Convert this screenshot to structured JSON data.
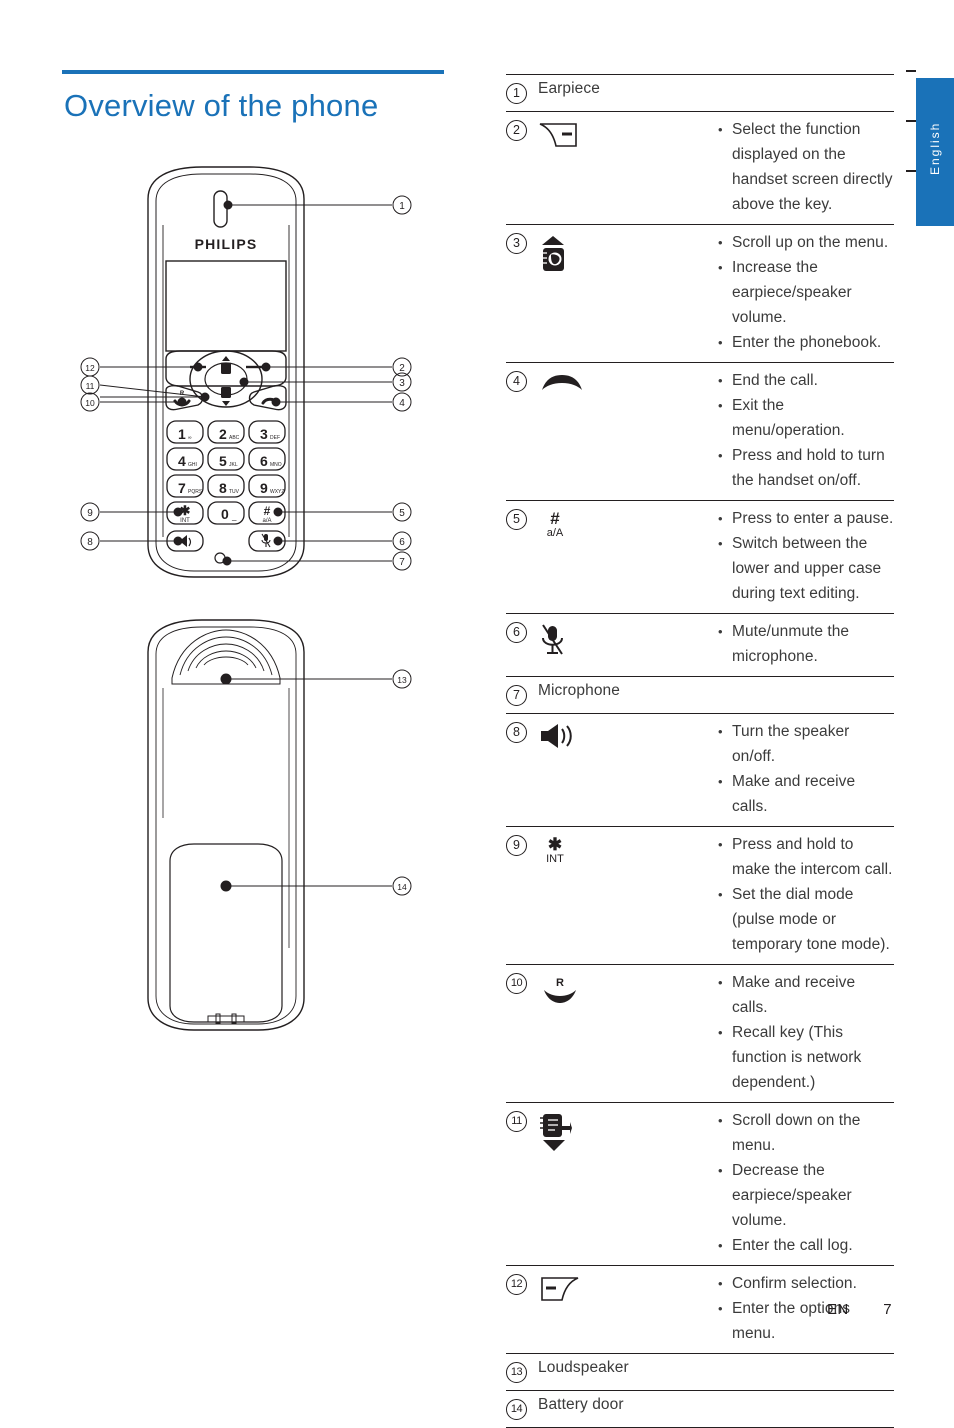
{
  "page": {
    "title": "Overview of the phone",
    "language_tab": "English",
    "footer_code": "EN",
    "footer_page": "7",
    "accent_color": "#1a72b8",
    "text_color": "#3b3b3b",
    "line_color": "#231f20"
  },
  "figure": {
    "brand": "PHILIPS",
    "front_callouts": [
      "1",
      "2",
      "3",
      "4",
      "5",
      "6",
      "7",
      "8",
      "9",
      "10",
      "11",
      "12"
    ],
    "back_callouts": [
      "13",
      "14"
    ],
    "keypad": [
      {
        "digit": "1",
        "letters": ""
      },
      {
        "digit": "2",
        "letters": "ABC"
      },
      {
        "digit": "3",
        "letters": "DEF"
      },
      {
        "digit": "4",
        "letters": "GHI"
      },
      {
        "digit": "5",
        "letters": "JKL"
      },
      {
        "digit": "6",
        "letters": "MNO"
      },
      {
        "digit": "7",
        "letters": "PQRS"
      },
      {
        "digit": "8",
        "letters": "TUV"
      },
      {
        "digit": "9",
        "letters": "WXYZ"
      },
      {
        "digit": "*",
        "letters": "INT"
      },
      {
        "digit": "0",
        "letters": "_"
      },
      {
        "digit": "#",
        "letters": "a/A"
      }
    ]
  },
  "table": {
    "rows": [
      {
        "num": "1",
        "icon": "earpiece",
        "label": "Earpiece",
        "bullets": []
      },
      {
        "num": "2",
        "icon": "right-softkey-icon",
        "label": "",
        "bullets": [
          "Select the function displayed on the handset screen directly above the key."
        ]
      },
      {
        "num": "3",
        "icon": "scroll-up-phonebook-icon",
        "label": "",
        "bullets": [
          "Scroll up on the menu.",
          "Increase the earpiece/speaker volume.",
          "Enter the phonebook."
        ]
      },
      {
        "num": "4",
        "icon": "end-call-icon",
        "label": "",
        "bullets": [
          "End the call.",
          "Exit the menu/operation.",
          "Press and hold to turn the handset on/off."
        ]
      },
      {
        "num": "5",
        "icon": "hash-key-icon",
        "icon_text_primary": "#",
        "icon_text_secondary": "a/A",
        "label": "",
        "bullets": [
          "Press to enter a pause.",
          "Switch between the lower and upper case during text editing."
        ]
      },
      {
        "num": "6",
        "icon": "mute-microphone-icon",
        "label": "",
        "bullets": [
          "Mute/unmute the microphone."
        ]
      },
      {
        "num": "7",
        "icon": "microphone",
        "label": "Microphone",
        "bullets": []
      },
      {
        "num": "8",
        "icon": "speaker-icon",
        "label": "",
        "bullets": [
          "Turn the speaker on/off.",
          "Make and receive calls."
        ]
      },
      {
        "num": "9",
        "icon": "star-int-key-icon",
        "icon_text_primary": "✱",
        "icon_text_secondary": "INT",
        "label": "",
        "bullets": [
          "Press and hold to make the intercom call.",
          "Set the dial mode (pulse mode or temporary tone mode)."
        ]
      },
      {
        "num": "10",
        "icon": "talk-recall-icon",
        "icon_text_primary": "R",
        "label": "",
        "bullets": [
          "Make and receive calls.",
          "Recall key (This function is network dependent.)"
        ]
      },
      {
        "num": "11",
        "icon": "scroll-down-calllog-icon",
        "label": "",
        "bullets": [
          "Scroll down on the menu.",
          "Decrease the earpiece/speaker volume.",
          "Enter the call log."
        ]
      },
      {
        "num": "12",
        "icon": "left-softkey-icon",
        "label": "",
        "bullets": [
          "Confirm selection.",
          "Enter the options menu."
        ]
      },
      {
        "num": "13",
        "icon": "loudspeaker",
        "label": "Loudspeaker",
        "bullets": []
      },
      {
        "num": "14",
        "icon": "battery-door",
        "label": "Battery door",
        "bullets": []
      }
    ]
  }
}
